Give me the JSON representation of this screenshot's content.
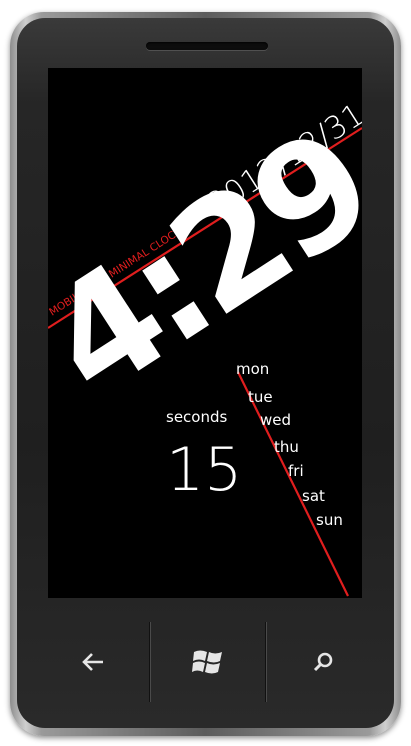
{
  "clock": {
    "date": "2012/12/31",
    "app_label": "MOBILETUTS MINIMAL CLOCK",
    "time": "4:29",
    "seconds_label": "seconds",
    "seconds_value": "15",
    "days": [
      "mon",
      "tue",
      "wed",
      "thu",
      "fri",
      "sat",
      "sun"
    ]
  },
  "colors": {
    "accent": "#e01e1e",
    "text": "#ffffff",
    "screen_bg": "#000000"
  },
  "nav": {
    "back_icon": "back-arrow-icon",
    "start_icon": "windows-logo-icon",
    "search_icon": "search-icon"
  }
}
